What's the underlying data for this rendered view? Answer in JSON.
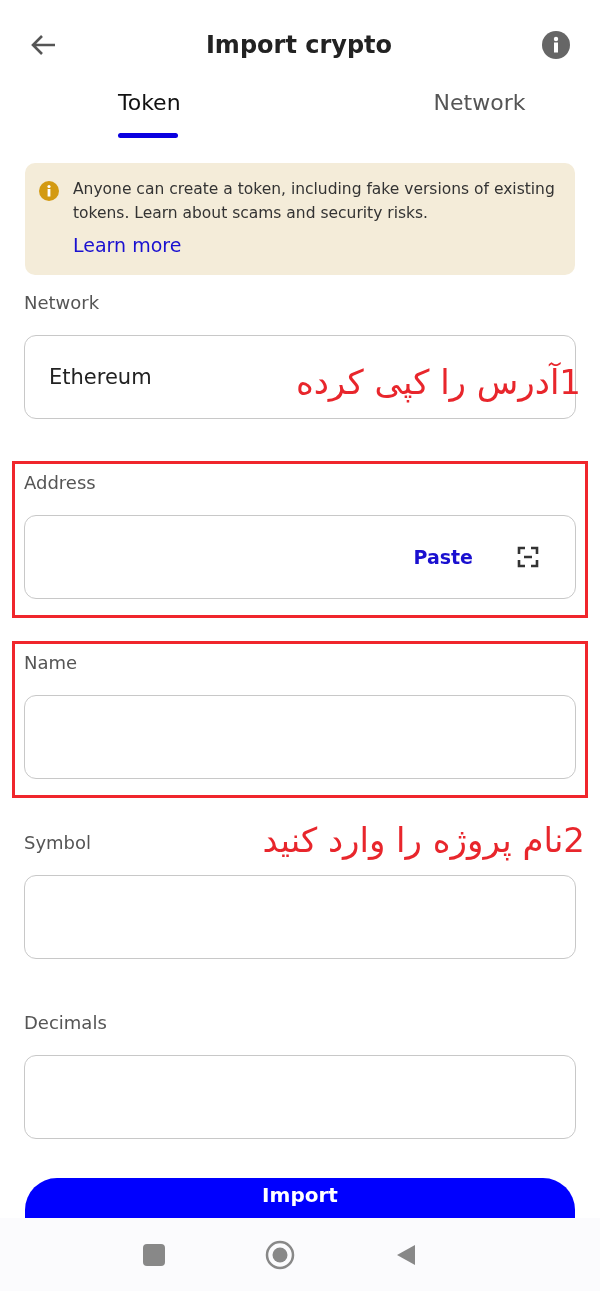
{
  "header": {
    "title": "Import crypto"
  },
  "tabs": [
    {
      "label": "Token",
      "selected": true
    },
    {
      "label": "Network",
      "selected": false
    }
  ],
  "notice": {
    "text": "Anyone can create a token, including fake versions of existing tokens. Learn about scams and security risks.",
    "link": "Learn more"
  },
  "fields": [
    {
      "label": "Network",
      "value": "Ethereum",
      "highlighted": false,
      "annotation": {
        "text": "1آدرس را کپی کرده",
        "kind": "field"
      }
    },
    {
      "label": "Address",
      "action": "Paste",
      "scan": true,
      "highlighted": true
    },
    {
      "label": "Name",
      "highlighted": true
    },
    {
      "label": "Symbol",
      "highlighted": false,
      "annotation": {
        "text": "2نام پروژه را وارد کنید",
        "kind": "label"
      }
    },
    {
      "label": "Decimals",
      "highlighted": false
    }
  ],
  "import_button": "Import"
}
